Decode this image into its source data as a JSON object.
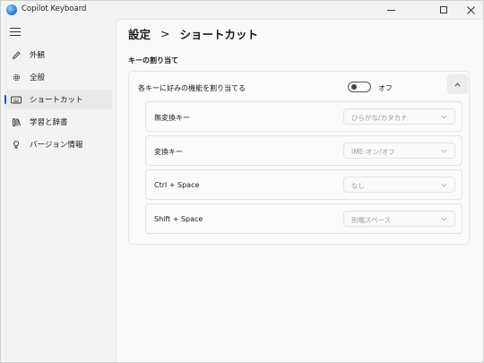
{
  "window": {
    "title": "Copilot Keyboard"
  },
  "sidebar": {
    "items": [
      {
        "label": "外観",
        "icon": "pencil-icon",
        "active": false
      },
      {
        "label": "全般",
        "icon": "gear-icon",
        "active": false
      },
      {
        "label": "ショートカット",
        "icon": "keyboard-icon",
        "active": true
      },
      {
        "label": "学習と辞書",
        "icon": "books-icon",
        "active": false
      },
      {
        "label": "バージョン情報",
        "icon": "info-icon",
        "active": false
      }
    ]
  },
  "header": {
    "breadcrumb_parent": "設定",
    "breadcrumb_separator": ">",
    "breadcrumb_current": "ショートカット"
  },
  "section": {
    "title": "キーの割り当て",
    "master_label": "各キーに好みの機能を割り当てる",
    "toggle_state": "オフ",
    "toggle_on": false
  },
  "shortcuts": [
    {
      "key": "無変換キー",
      "value": "ひらがな/カタカナ",
      "enabled": false
    },
    {
      "key": "変換キー",
      "value": "IME-オン/オフ",
      "enabled": false
    },
    {
      "key": "Ctrl + Space",
      "value": "なし",
      "enabled": false
    },
    {
      "key": "Shift + Space",
      "value": "別幅スペース",
      "enabled": false
    }
  ],
  "colors": {
    "accent": "#1a5fb4",
    "disabled_text": "#9a9a9a"
  }
}
